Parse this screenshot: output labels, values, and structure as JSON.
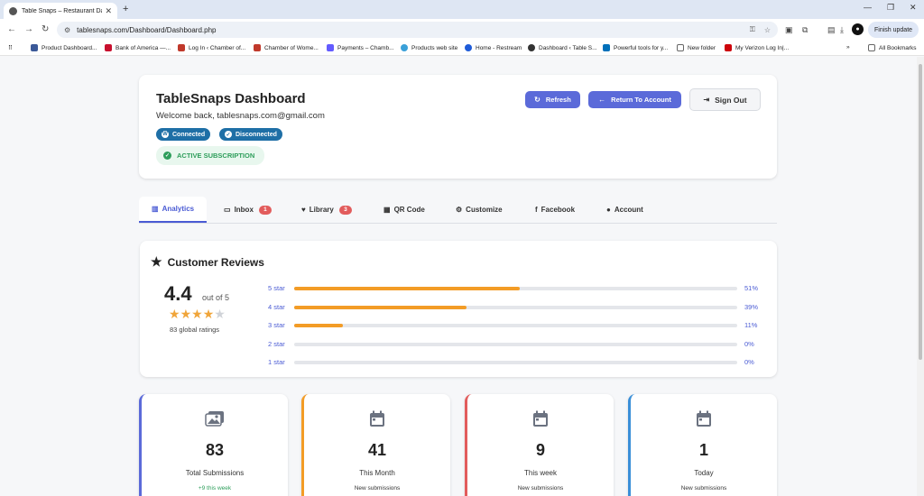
{
  "browser": {
    "tab_title": "Table Snaps – Restaurant Dashb",
    "url": "tablesnaps.com/Dashboard/Dashboard.php",
    "finish_update": "Finish update",
    "bookmarks": [
      {
        "label": "Product Dashboard...",
        "color": "#3b5998"
      },
      {
        "label": "Bank of America —...",
        "color": "#c8102e"
      },
      {
        "label": "Log In ‹ Chamber of...",
        "color": "#c0392b"
      },
      {
        "label": "Chamber of Wome...",
        "color": "#c0392b"
      },
      {
        "label": "Payments – Chamb...",
        "color": "#635bff"
      },
      {
        "label": "Products web site",
        "color": "#3aa0d8"
      },
      {
        "label": "Home - Restream",
        "color": "#1e5bd8"
      },
      {
        "label": "Dashboard ‹ Table S...",
        "color": "#333333"
      },
      {
        "label": "Powerful tools for y...",
        "color": "#0070ba"
      },
      {
        "label": "New folder",
        "color": "#666666"
      },
      {
        "label": "My Verizon Log In|...",
        "color": "#cd040b"
      }
    ],
    "all_bookmarks": "All Bookmarks"
  },
  "header": {
    "title": "TableSnaps Dashboard",
    "welcome": "Welcome back, tablesnaps.com@gmail.com",
    "status_connected": "Connected",
    "status_disconnected": "Disconnected",
    "subscription": "ACTIVE SUBSCRIPTION",
    "refresh": "Refresh",
    "return_account": "Return To Account",
    "sign_out": "Sign Out"
  },
  "tabs": [
    {
      "label": "Analytics",
      "icon": "chart-icon",
      "count": null,
      "active": true
    },
    {
      "label": "Inbox",
      "icon": "inbox-icon",
      "count": "1",
      "active": false
    },
    {
      "label": "Library",
      "icon": "heart-icon",
      "count": "3",
      "active": false
    },
    {
      "label": "QR Code",
      "icon": "qr-icon",
      "count": null,
      "active": false
    },
    {
      "label": "Customize",
      "icon": "gears-icon",
      "count": null,
      "active": false
    },
    {
      "label": "Facebook",
      "icon": "facebook-icon",
      "count": null,
      "active": false
    },
    {
      "label": "Account",
      "icon": "user-icon",
      "count": null,
      "active": false
    }
  ],
  "reviews": {
    "title": "Customer Reviews",
    "score": "4.4",
    "out_of": "out of 5",
    "star_rating": 4.4,
    "global_ratings": "83 global ratings",
    "rows": [
      {
        "label": "5 star",
        "pct_label": "51%",
        "pct": 51
      },
      {
        "label": "4 star",
        "pct_label": "39%",
        "pct": 39
      },
      {
        "label": "3 star",
        "pct_label": "11%",
        "pct": 11
      },
      {
        "label": "2 star",
        "pct_label": "0%",
        "pct": 0
      },
      {
        "label": "1 star",
        "pct_label": "0%",
        "pct": 0
      }
    ],
    "bar_color": "#f39c26"
  },
  "stats": [
    {
      "value": "83",
      "label": "Total Submissions",
      "sub": "+9 this week",
      "accent": "#5b6ad9",
      "icon": "images-icon"
    },
    {
      "value": "41",
      "label": "This Month",
      "sub": "New submissions",
      "accent": "#f39c26",
      "icon": "calendar-icon"
    },
    {
      "value": "9",
      "label": "This week",
      "sub": "New submissions",
      "accent": "#e25c5c",
      "icon": "calendar-icon"
    },
    {
      "value": "1",
      "label": "Today",
      "sub": "New submissions",
      "accent": "#3a8fd8",
      "icon": "calendar-icon"
    }
  ]
}
